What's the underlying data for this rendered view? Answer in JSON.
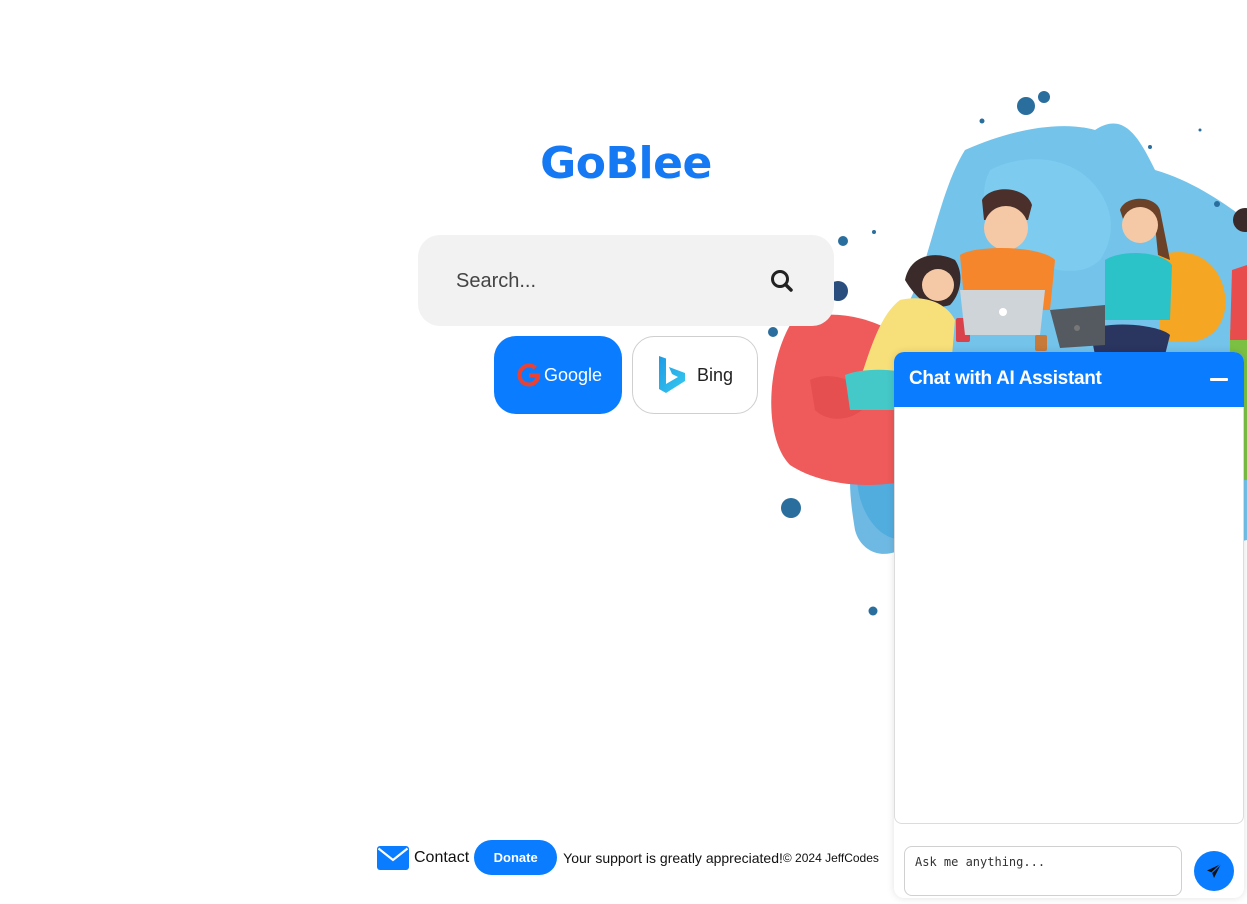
{
  "brand": {
    "title": "GoBlee"
  },
  "search": {
    "placeholder": "Search..."
  },
  "engines": [
    {
      "label": "Google"
    },
    {
      "label": "Bing"
    }
  ],
  "footer": {
    "contact_label": "Contact",
    "donate_label": "Donate",
    "support_text": "Your support is greatly appreciated!",
    "copyright_text": "© 2024 JeffCodes"
  },
  "chat": {
    "title": "Chat with AI Assistant",
    "input_placeholder": "Ask me anything..."
  },
  "icons": {
    "search": "search-icon",
    "google": "google-logo-icon",
    "bing": "bing-logo-icon",
    "mail": "envelope-icon",
    "minimize": "minimize-icon",
    "send": "paper-plane-icon"
  },
  "colors": {
    "accent": "#0a7cff",
    "brand_text": "#1479f2",
    "search_bg": "#f2f2f2"
  }
}
